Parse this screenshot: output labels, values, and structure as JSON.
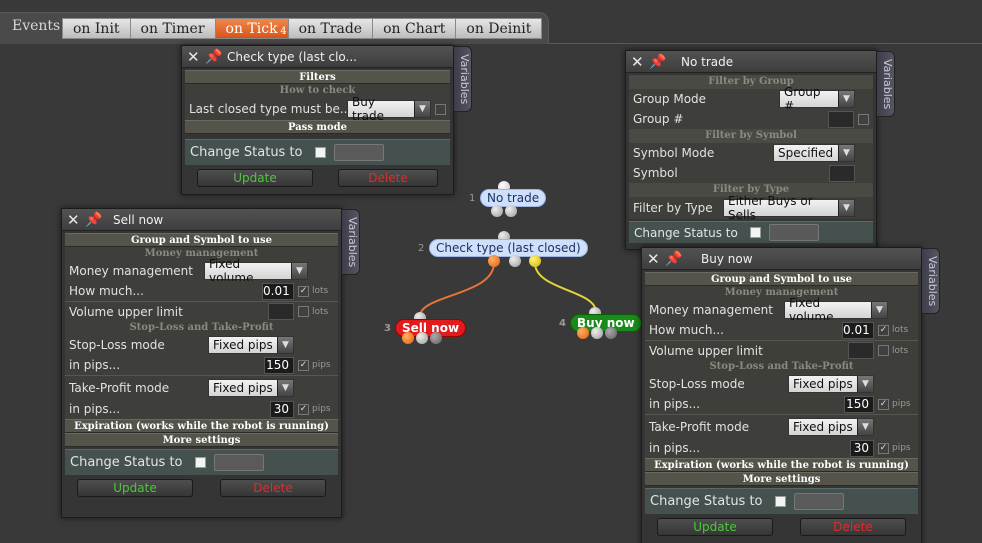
{
  "events_label": "Events",
  "tabs": [
    {
      "label": "on Init"
    },
    {
      "label": "on Timer"
    },
    {
      "label": "on Tick",
      "badge": "4"
    },
    {
      "label": "on Trade"
    },
    {
      "label": "on Chart"
    },
    {
      "label": "on Deinit"
    }
  ],
  "active_tab": "on Tick",
  "side_tab_label": "Variables",
  "check_type": {
    "title": "Check type (last clo...",
    "sec_filters": "Filters",
    "sub_how": "How to check",
    "last_closed_label": "Last closed type must be...",
    "last_closed_value": "Buy trade",
    "sec_pass": "Pass mode",
    "status_label": "Change Status to",
    "update": "Update",
    "delete": "Delete"
  },
  "no_trade": {
    "title": "No trade",
    "sub_group": "Filter by Group",
    "group_mode_label": "Group Mode",
    "group_mode_value": "Group #",
    "group_num_label": "Group #",
    "sub_symbol": "Filter by Symbol",
    "symbol_mode_label": "Symbol Mode",
    "symbol_mode_value": "Specified",
    "symbol_label": "Symbol",
    "sub_type": "Filter by Type",
    "filter_type_label": "Filter by Type",
    "filter_type_value": "Either Buys or Sells",
    "status_label": "Change Status to"
  },
  "sell_now": {
    "title": "Sell now",
    "sec_group": "Group and Symbol to use",
    "sub_money": "Money management",
    "mm_label": "Money management",
    "mm_value": "Fixed volume",
    "how_much_label": "How much...",
    "how_much_value": "0.01",
    "lots": "lots",
    "vol_limit_label": "Volume upper limit",
    "sub_sltp": "Stop-Loss and Take-Profit",
    "sl_mode_label": "Stop-Loss mode",
    "sl_mode_value": "Fixed pips",
    "in_pips_label": "in pips...",
    "sl_pips": "150",
    "pips": "pips",
    "tp_mode_label": "Take-Profit mode",
    "tp_mode_value": "Fixed pips",
    "tp_pips": "30",
    "sec_expiration": "Expiration (works while the robot is running)",
    "sec_more": "More settings",
    "status_label": "Change Status to",
    "update": "Update",
    "delete": "Delete"
  },
  "buy_now": {
    "title": "Buy now",
    "sec_group": "Group and Symbol to use",
    "sub_money": "Money management",
    "mm_label": "Money management",
    "mm_value": "Fixed volume",
    "how_much_label": "How much...",
    "how_much_value": "0.01",
    "lots": "lots",
    "vol_limit_label": "Volume upper limit",
    "sub_sltp": "Stop-Loss and Take-Profit",
    "sl_mode_label": "Stop-Loss mode",
    "sl_mode_value": "Fixed pips",
    "in_pips_label": "in pips...",
    "sl_pips": "150",
    "pips": "pips",
    "tp_mode_label": "Take-Profit mode",
    "tp_mode_value": "Fixed pips",
    "tp_pips": "30",
    "sec_expiration": "Expiration (works while the robot is running)",
    "sec_more": "More settings",
    "status_label": "Change Status to",
    "update": "Update",
    "delete": "Delete"
  },
  "graph": {
    "nodes": [
      {
        "index": "1",
        "label": "No trade"
      },
      {
        "index": "2",
        "label": "Check type (last closed)"
      },
      {
        "index": "3",
        "label": "Sell now"
      },
      {
        "index": "4",
        "label": "Buy now"
      }
    ],
    "link_colors": {
      "orange": "#e8733a",
      "yellow": "#e6d23a"
    }
  }
}
